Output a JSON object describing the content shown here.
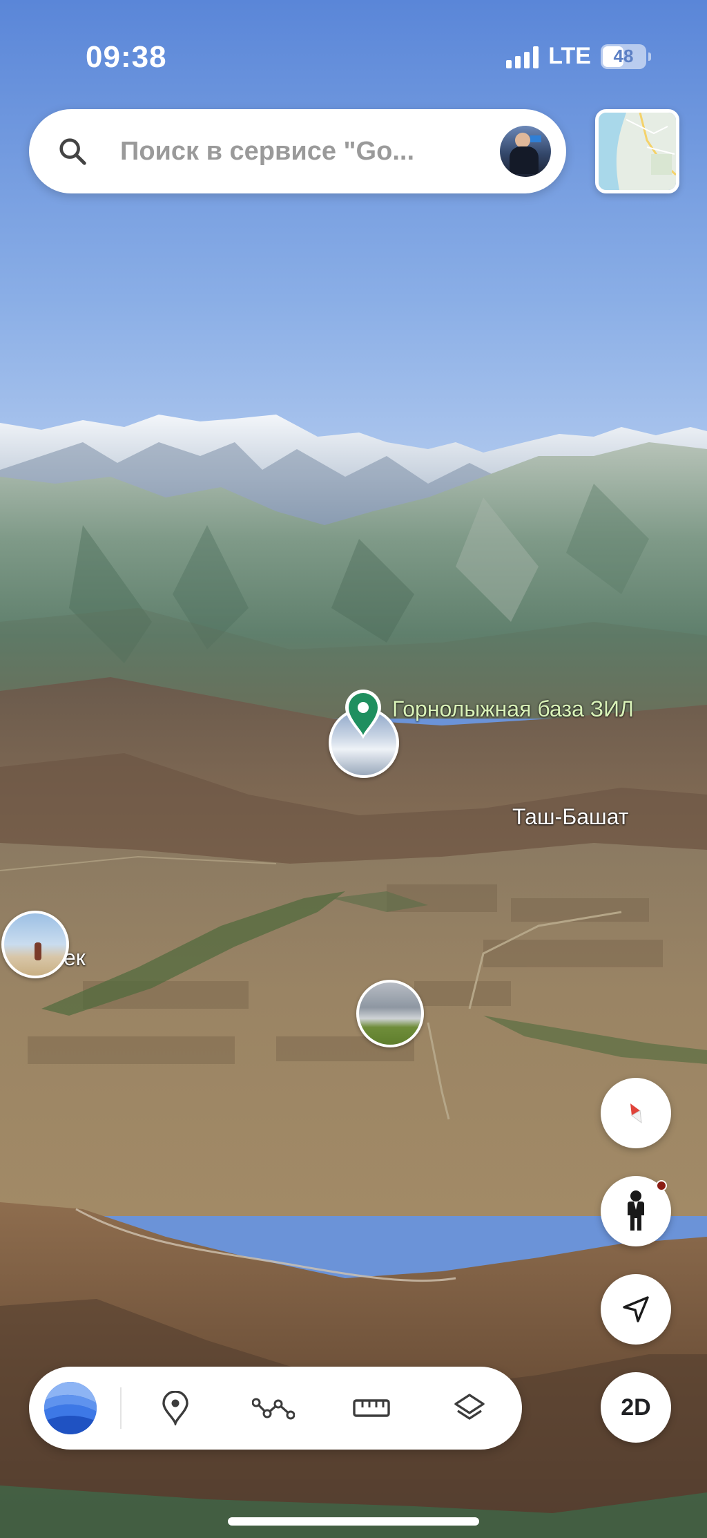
{
  "status_bar": {
    "time": "09:38",
    "network": "LTE",
    "battery": "48"
  },
  "search": {
    "placeholder": "Поиск в сервисе \"Go...",
    "icon": "search-icon"
  },
  "map_labels": {
    "poi_name": "Горнолыжная база ЗИЛ",
    "village_1": "Таш-Башат",
    "village_2_partial": "ек"
  },
  "controls": {
    "mode_toggle": "2D",
    "compass_icon": "compass-icon",
    "street_view_icon": "pegman-icon",
    "locate_icon": "my-location-icon"
  },
  "toolbar": {
    "items": [
      "earth-logo-icon",
      "place-pin-icon",
      "path-icon",
      "ruler-icon",
      "layers-icon"
    ]
  },
  "colors": {
    "sky_top": "#5c88d9",
    "poi_label": "#d9f2b8",
    "pin_green": "#1f8f5f",
    "compass_red": "#e0433a"
  }
}
